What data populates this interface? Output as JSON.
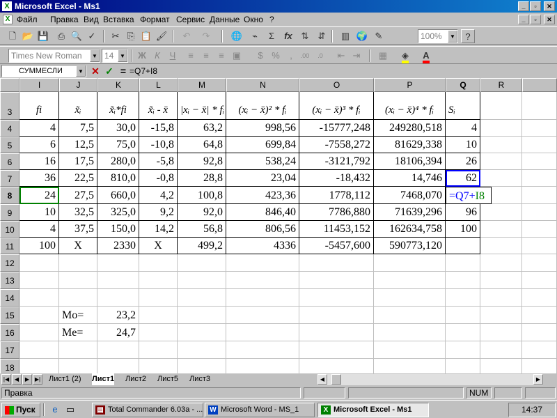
{
  "window": {
    "title": "Microsoft Excel - Ms1"
  },
  "menu": [
    "Файл",
    "Правка",
    "Вид",
    "Вставка",
    "Формат",
    "Сервис",
    "Данные",
    "Окно",
    "?"
  ],
  "toolbar": {
    "zoom": "100%",
    "font": "Times New Roman",
    "size": "14"
  },
  "formula_bar": {
    "name_box": "СУММЕСЛИ",
    "equals": "=",
    "formula": "=Q7+I8"
  },
  "grid": {
    "columns": [
      "I",
      "J",
      "K",
      "L",
      "M",
      "N",
      "O",
      "P",
      "Q",
      "R"
    ],
    "rows": [
      "3",
      "4",
      "5",
      "6",
      "7",
      "8",
      "9",
      "10",
      "11",
      "12",
      "13",
      "14",
      "15",
      "16",
      "17",
      "18"
    ],
    "header_row": [
      "fi",
      "x̃ᵢ",
      "x̃ᵢ*fi",
      "x̃ᵢ - x̄",
      "|xᵢ − x̄| * fᵢ",
      "(xᵢ − x̄)² * fᵢ",
      "(xᵢ − x̄)³ * fᵢ",
      "(xᵢ − x̄)⁴ * fᵢ",
      "Sᵢ"
    ],
    "data": [
      [
        "4",
        "7,5",
        "30,0",
        "-15,8",
        "63,2",
        "998,56",
        "-15777,248",
        "249280,518",
        "4"
      ],
      [
        "6",
        "12,5",
        "75,0",
        "-10,8",
        "64,8",
        "699,84",
        "-7558,272",
        "81629,338",
        "10"
      ],
      [
        "16",
        "17,5",
        "280,0",
        "-5,8",
        "92,8",
        "538,24",
        "-3121,792",
        "18106,394",
        "26"
      ],
      [
        "36",
        "22,5",
        "810,0",
        "-0,8",
        "28,8",
        "23,04",
        "-18,432",
        "14,746",
        "62"
      ],
      [
        "24",
        "27,5",
        "660,0",
        "4,2",
        "100,8",
        "423,36",
        "1778,112",
        "7468,070",
        "=Q7+I8"
      ],
      [
        "10",
        "32,5",
        "325,0",
        "9,2",
        "92,0",
        "846,40",
        "7786,880",
        "71639,296",
        "96"
      ],
      [
        "4",
        "37,5",
        "150,0",
        "14,2",
        "56,8",
        "806,56",
        "11453,152",
        "162634,758",
        "100"
      ],
      [
        "100",
        "X",
        "2330",
        "X",
        "499,2",
        "4336",
        "-5457,600",
        "590773,120",
        ""
      ]
    ],
    "mo_label": "Mo=",
    "mo_value": "23,2",
    "me_label": "Me=",
    "me_value": "24,7"
  },
  "sheets": [
    "Лист1 (2)",
    "Лист1",
    "Лист2",
    "Лист5",
    "Лист3"
  ],
  "status": {
    "mode": "Правка",
    "num": "NUM"
  },
  "taskbar": {
    "start": "Пуск",
    "tasks": [
      "Total Commander 6.03a - ...",
      "Microsoft Word - MS_1",
      "Microsoft Excel - Ms1"
    ],
    "clock": "14:37"
  },
  "colors": {
    "title_bar": "#000080",
    "ref_blue": "#0000ff",
    "ref_green": "#008000",
    "face": "#c0c0c0"
  }
}
